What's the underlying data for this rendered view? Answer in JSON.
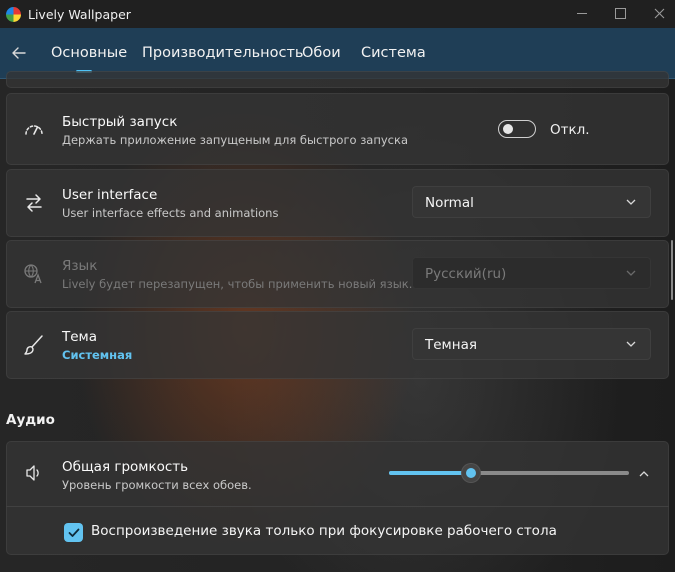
{
  "window": {
    "title": "Lively Wallpaper"
  },
  "nav": {
    "back_icon": "arrow-left-icon",
    "tabs": [
      {
        "label": "Основные",
        "selected": true
      },
      {
        "label": "Производительность",
        "selected": false
      },
      {
        "label": "Обои",
        "selected": false
      },
      {
        "label": "Система",
        "selected": false
      }
    ]
  },
  "settings": {
    "quick_launch": {
      "icon": "speedometer-icon",
      "title": "Быстрый запуск",
      "subtitle": "Держать приложение запущеным для быстрого запуска",
      "toggle_on": false,
      "toggle_label": "Откл."
    },
    "user_interface": {
      "icon": "swap-arrows-icon",
      "title": "User interface",
      "subtitle": "User interface effects and animations",
      "value": "Normal"
    },
    "language": {
      "icon": "language-icon",
      "title": "Язык",
      "subtitle": "Lively будет перезапущен, чтобы применить новый язык.",
      "value": "Русский(ru)",
      "disabled": true
    },
    "theme": {
      "icon": "brush-icon",
      "title": "Тема",
      "subtitle": "Системная",
      "value": "Темная"
    }
  },
  "audio": {
    "section_title": "Аудио",
    "master_volume": {
      "icon": "speaker-icon",
      "title": "Общая громкость",
      "subtitle": "Уровень громкости всех обоев.",
      "level_fraction": 0.34,
      "expanded": true
    },
    "focus_only": {
      "checked": true,
      "label": "Воспроизведение звука только при фокусировке рабочего стола"
    }
  },
  "colors": {
    "accent": "#62c3f0",
    "nav_bg": "#1f3e56"
  }
}
